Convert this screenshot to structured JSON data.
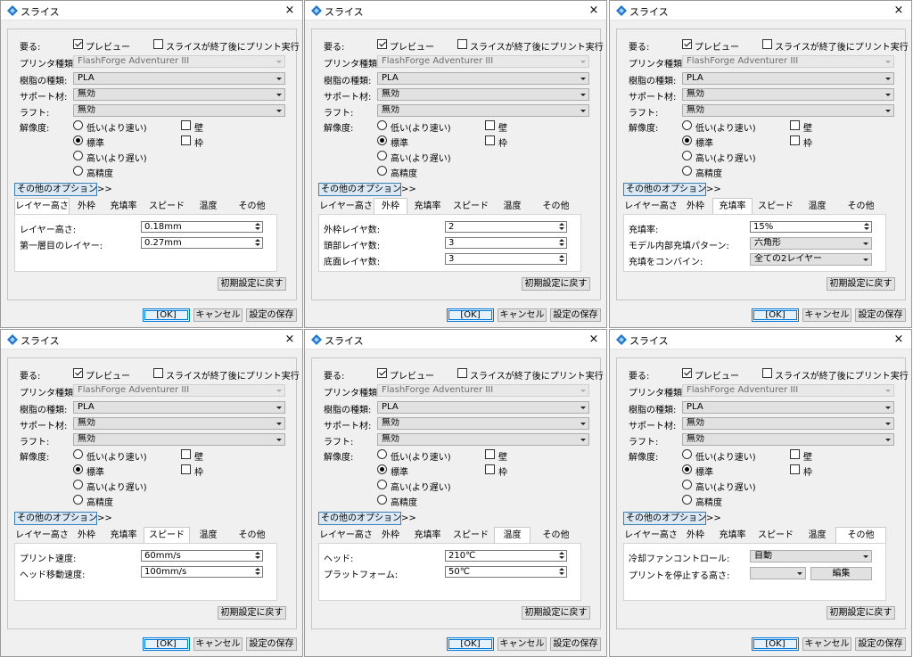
{
  "dialogs": [
    {
      "title": "スライス",
      "active_tab": 0,
      "fields_type": "layers"
    },
    {
      "title": "スライス",
      "active_tab": 1,
      "fields_type": "walls"
    },
    {
      "title": "スライス",
      "active_tab": 2,
      "fields_type": "infill"
    },
    {
      "title": "スライス",
      "active_tab": 3,
      "fields_type": "speed"
    },
    {
      "title": "スライス",
      "active_tab": 4,
      "fields_type": "temp"
    },
    {
      "title": "スライス",
      "active_tab": 5,
      "fields_type": "other"
    }
  ],
  "common": {
    "required_label": "要る:",
    "preview_label": "プレビュー",
    "print_after_label": "スライスが終了後にプリント実行",
    "printer_type_label": "プリンタ種類:",
    "printer_type_value": "FlashForge Adventurer III",
    "resin_label": "樹脂の種類:",
    "resin_value": "PLA",
    "support_label": "サポート材:",
    "support_value": "無効",
    "raft_label": "ラフト:",
    "raft_value": "無効",
    "resolution_label": "解像度:",
    "res_low": "低い(より速い)",
    "res_std": "標準",
    "res_high": "高い(より遅い)",
    "res_hq": "高精度",
    "wall_label": "壁",
    "frame_label": "枠",
    "more_options": "その他のオプション>>",
    "tabs": [
      "レイヤー高さ",
      "外枠",
      "充填率",
      "スピード",
      "温度",
      "その他"
    ],
    "reset_label": "初期設定に戻す",
    "ok_label": "[OK]",
    "cancel_label": "キャンセル",
    "save_label": "設定の保存",
    "close_icon": "×"
  },
  "panels": {
    "layers": [
      {
        "label": "レイヤー高さ:",
        "value": "0.18mm"
      },
      {
        "label": "第一層目のレイヤー:",
        "value": "0.27mm"
      }
    ],
    "walls": [
      {
        "label": "外枠レイヤ数:",
        "value": "2"
      },
      {
        "label": "頭部レイヤ数:",
        "value": "3"
      },
      {
        "label": "底面レイヤ数:",
        "value": "3"
      }
    ],
    "infill": {
      "rate_label": "充填率:",
      "rate_value": "15%",
      "pattern_label": "モデル内部充填パターン:",
      "pattern_value": "六角形",
      "combine_label": "充填をコンバイン:",
      "combine_value": "全ての2レイヤー"
    },
    "speed": [
      {
        "label": "プリント速度:",
        "value": "60mm/s"
      },
      {
        "label": "ヘッド移動速度:",
        "value": "100mm/s"
      }
    ],
    "temp": [
      {
        "label": "ヘッド:",
        "value": "210℃"
      },
      {
        "label": "プラットフォーム:",
        "value": "50℃"
      }
    ],
    "other": {
      "fan_label": "冷却ファンコントロール:",
      "fan_value": "自動",
      "pause_label": "プリントを停止する高さ:",
      "pause_value": "",
      "edit_label": "編集"
    }
  },
  "colors": {
    "accent": "#0078d7",
    "app_icon": "#1e74c8"
  }
}
